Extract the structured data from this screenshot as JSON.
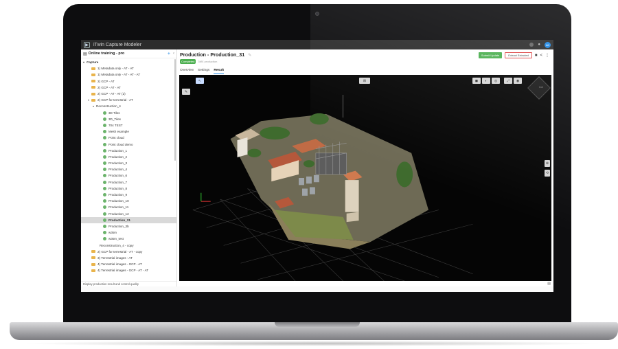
{
  "app": {
    "title": "iTwin Capture Modeler",
    "avatar_initials": "AK"
  },
  "sidebar": {
    "project_title": "Online training - pro",
    "root_label": "Capture",
    "items": [
      {
        "label": "1) Metadata only - AT - AT",
        "kind": "folder"
      },
      {
        "label": "1) Metadata only - AT - AT - AT",
        "kind": "folder"
      },
      {
        "label": "2) GCP - AT",
        "kind": "folder"
      },
      {
        "label": "2) GCP - AT - AT",
        "kind": "folder"
      },
      {
        "label": "2) GCP - AT - AT (2)",
        "kind": "folder"
      },
      {
        "label": "2) GCP for terrestrial - AT",
        "kind": "folder"
      },
      {
        "label": "Reconstruction_4",
        "kind": "reconstruction"
      },
      {
        "label": "3D Tiles",
        "kind": "production"
      },
      {
        "label": "3D_Tiles",
        "kind": "production"
      },
      {
        "label": "704 TEST",
        "kind": "production"
      },
      {
        "label": "Mesh example",
        "kind": "production"
      },
      {
        "label": "Point cloud",
        "kind": "production"
      },
      {
        "label": "Point cloud demo",
        "kind": "production"
      },
      {
        "label": "Production_1",
        "kind": "production"
      },
      {
        "label": "Production_2",
        "kind": "production"
      },
      {
        "label": "Production_3",
        "kind": "production"
      },
      {
        "label": "Production_4",
        "kind": "production"
      },
      {
        "label": "Production_6",
        "kind": "production"
      },
      {
        "label": "Production_7",
        "kind": "production"
      },
      {
        "label": "Production_8",
        "kind": "production"
      },
      {
        "label": "Production_9",
        "kind": "production"
      },
      {
        "label": "Production_10",
        "kind": "production"
      },
      {
        "label": "Production_11",
        "kind": "production"
      },
      {
        "label": "Production_12",
        "kind": "production"
      },
      {
        "label": "Production_31",
        "kind": "production",
        "selected": true
      },
      {
        "label": "Production_3b",
        "kind": "production"
      },
      {
        "label": "w3sm",
        "kind": "production"
      },
      {
        "label": "w3sm_test",
        "kind": "production"
      },
      {
        "label": "Reconstruction_4 - copy",
        "kind": "reconstruction-plain"
      },
      {
        "label": "2) GCP for terrestrial - AT - copy",
        "kind": "folder"
      },
      {
        "label": "3) Terrestrial images - AT",
        "kind": "folder"
      },
      {
        "label": "4) Terrestrial images - GCP - AT",
        "kind": "folder"
      },
      {
        "label": "4) Terrestrial images - GCP - AT - AT",
        "kind": "folder"
      }
    ],
    "footer": "Display production result and control quality"
  },
  "content": {
    "title": "Production - Production_31",
    "status_badge": "Completed",
    "subtitle": "3MX production",
    "buttons": {
      "submit": "Submit Update",
      "extract": "Extract Extruded"
    },
    "tabs": [
      "Overview",
      "Settings",
      "Result"
    ],
    "active_tab": "Result"
  },
  "viewport": {
    "background": "#050505",
    "cube_label": "TOP"
  },
  "colors": {
    "accent": "#1e88e5",
    "success": "#4caf50",
    "folder": "#e9b44c"
  }
}
